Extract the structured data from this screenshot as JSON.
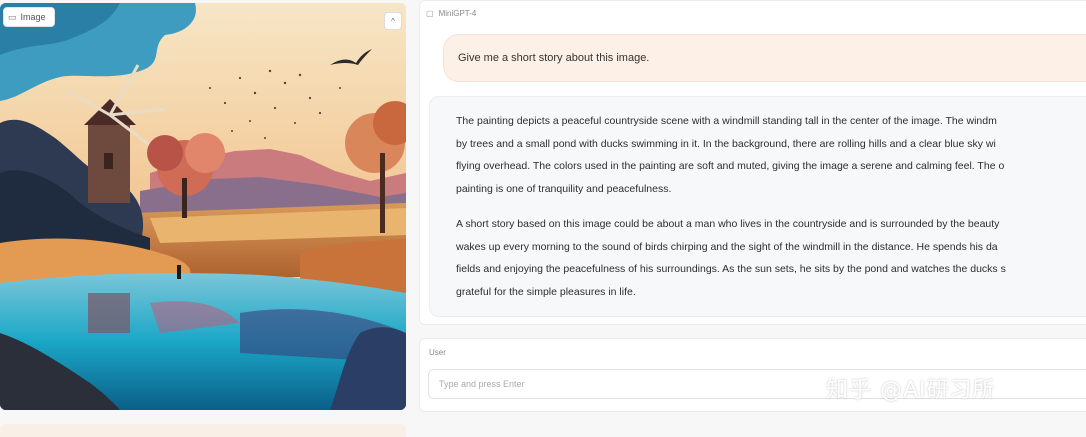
{
  "image_panel": {
    "label": "Image",
    "label_icon": "image-icon",
    "collapse_icon": "chevron-up-icon",
    "collapse_glyph": "^"
  },
  "chat": {
    "label": "MiniGPT-4",
    "label_icon": "chat-icon",
    "user_message": "Give me a short story about this image.",
    "bot_paragraph_1_lines": [
      "The painting depicts a peaceful countryside scene with a windmill standing tall in the center of the image. The windm",
      "by trees and a small pond with ducks swimming in it. In the background, there are rolling hills and a clear blue sky wi",
      "flying overhead. The colors used in the painting are soft and muted, giving the image a serene and calming feel. The o",
      "painting is one of tranquility and peacefulness."
    ],
    "bot_paragraph_2_lines": [
      "A short story based on this image could be about a man who lives in the countryside and is surrounded by the beauty",
      "wakes up every morning to the sound of birds chirping and the sight of the windmill in the distance. He spends his da",
      "fields and enjoying the peacefulness of his surroundings. As the sun sets, he sits by the pond and watches the ducks s",
      "grateful for the simple pleasures in life."
    ]
  },
  "input": {
    "label": "User",
    "placeholder": "Type and press Enter"
  },
  "watermark": "知乎 @AI研习所",
  "colors": {
    "user_bubble": "#fdf0e6",
    "bot_bubble": "#f7f8fa",
    "page_bg": "#f7f7f8"
  }
}
